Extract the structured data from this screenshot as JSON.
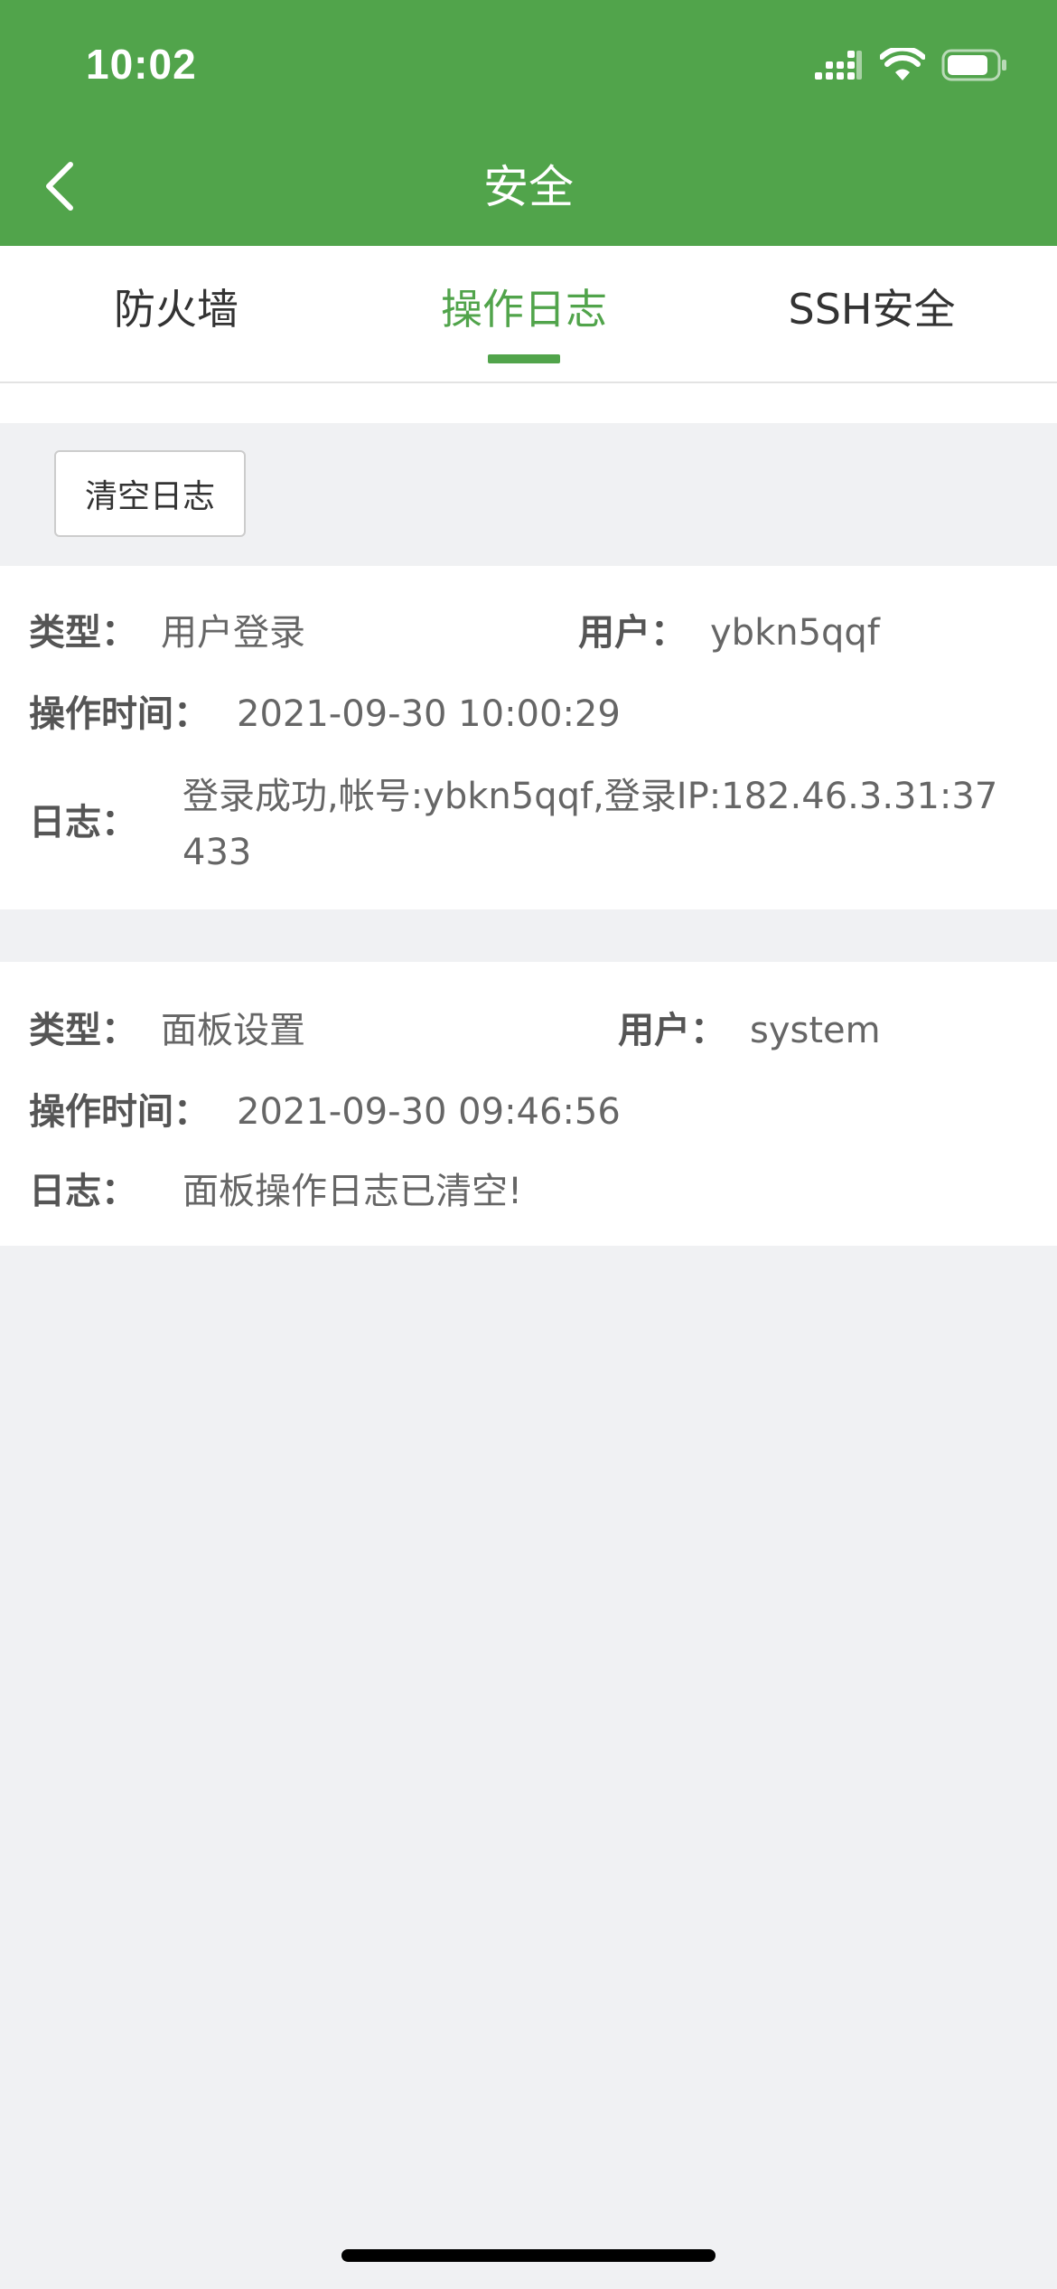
{
  "status_bar": {
    "time": "10:02",
    "icons": [
      "signal-icon",
      "wifi-icon",
      "battery-icon"
    ]
  },
  "nav": {
    "title": "安全",
    "back_icon": "chevron-left-icon"
  },
  "tabs": [
    {
      "label": "防火墙",
      "active": false
    },
    {
      "label": "操作日志",
      "active": true
    },
    {
      "label": "SSH安全",
      "active": false
    }
  ],
  "toolbar": {
    "clear_label": "清空日志"
  },
  "logs": [
    {
      "type_label": "类型：",
      "type_value": "用户登录",
      "user_label": "用户：",
      "user_value": "ybkn5qqf",
      "time_label": "操作时间：",
      "time_value": "2021-09-30 10:00:29",
      "log_label": "日志：",
      "log_value": "登录成功,帐号:ybkn5qqf,登录IP:182.46.3.31:37433"
    },
    {
      "type_label": "类型：",
      "type_value": "面板设置",
      "user_label": "用户：",
      "user_value": "system",
      "time_label": "操作时间：",
      "time_value": "2021-09-30 09:46:56",
      "log_label": "日志：",
      "log_value": "面板操作日志已清空!"
    }
  ],
  "colors": {
    "primary": "#51a44b",
    "background": "#f0f1f3",
    "text": "#333333"
  }
}
